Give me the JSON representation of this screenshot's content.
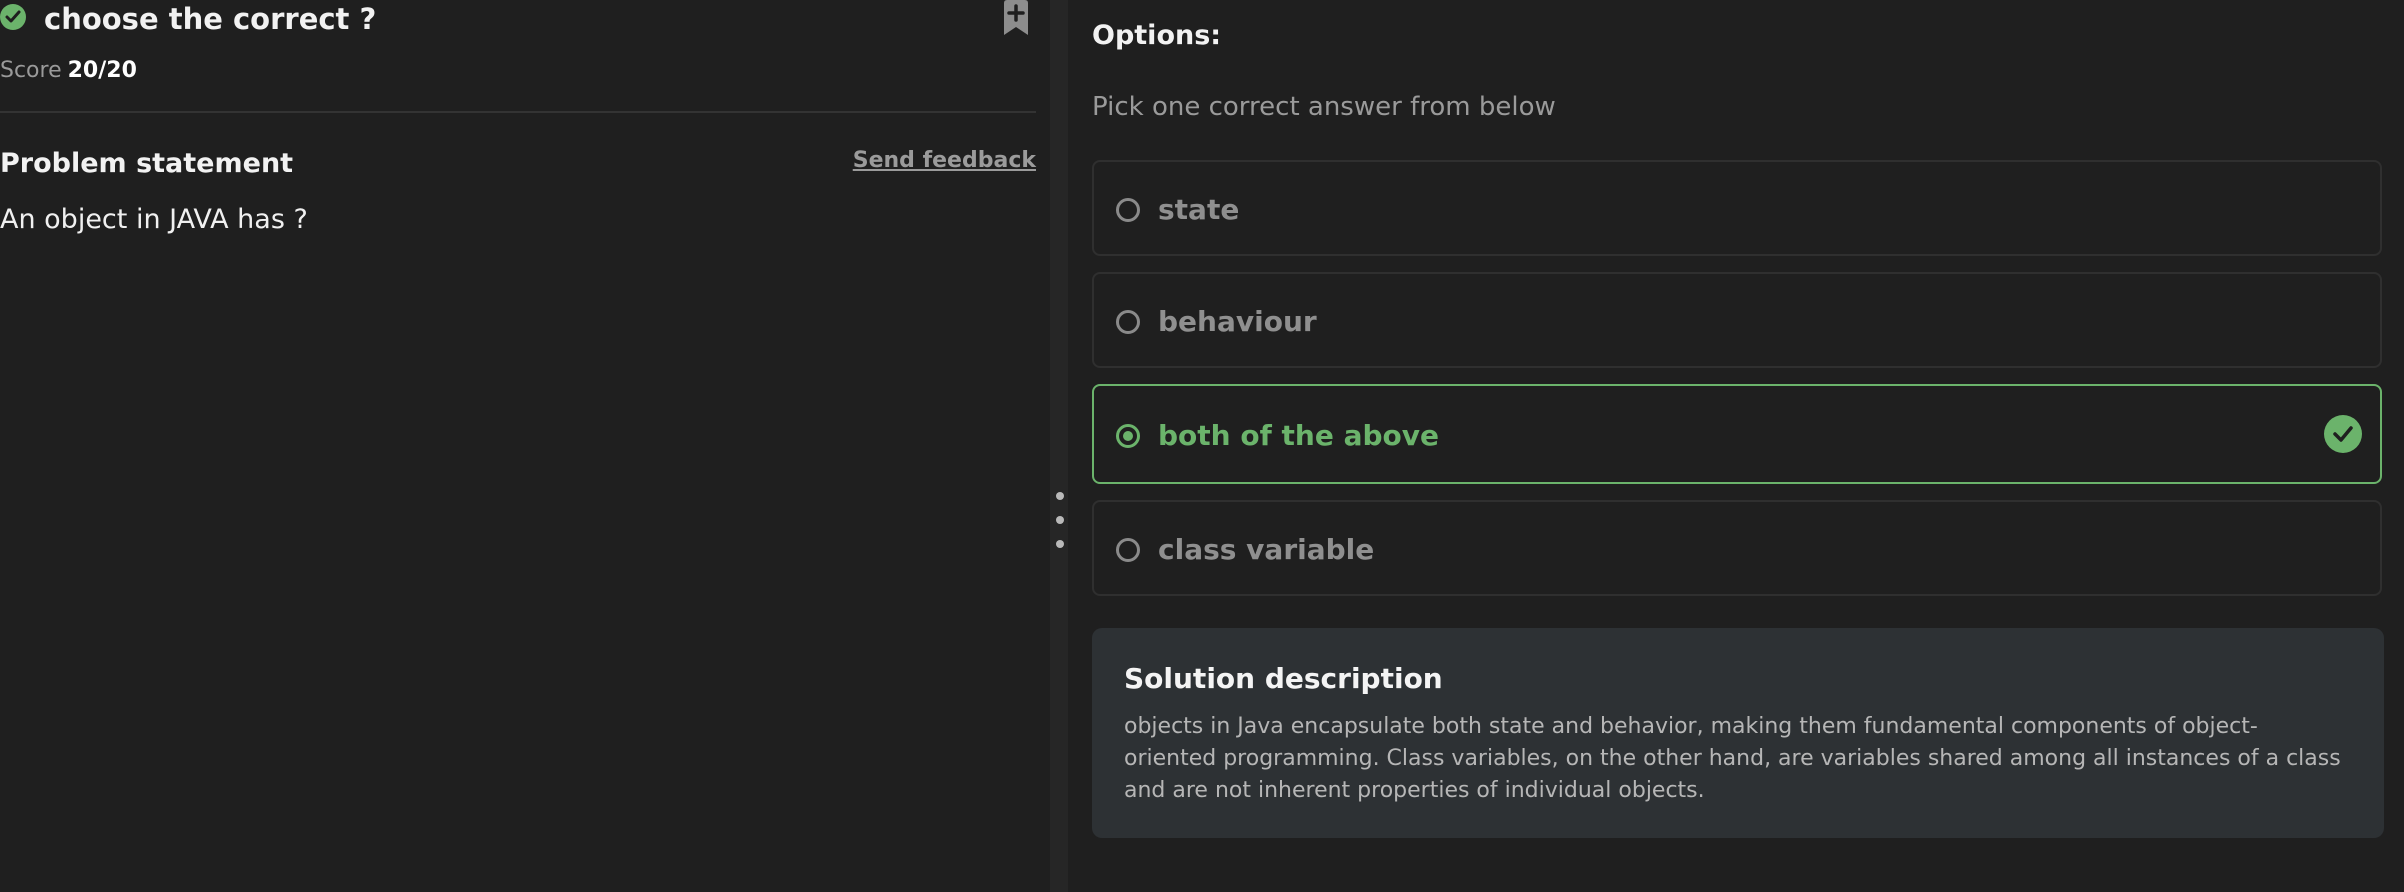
{
  "question": {
    "title": "choose the correct ?",
    "score_label": "Score",
    "score_value": "20/20",
    "status": "correct"
  },
  "problem": {
    "heading": "Problem statement",
    "feedback_label": "Send feedback",
    "statement": "An object in JAVA has ?"
  },
  "options_panel": {
    "heading": "Options:",
    "hint": "Pick one correct answer from below",
    "options": [
      {
        "label": "state",
        "selected": false
      },
      {
        "label": "behaviour",
        "selected": false
      },
      {
        "label": "both of the above",
        "selected": true,
        "correct": true
      },
      {
        "label": "class variable",
        "selected": false
      }
    ]
  },
  "solution": {
    "title": "Solution description",
    "text": "objects in Java encapsulate both state and behavior, making them fundamental components of object-oriented programming. Class variables, on the other hand, are variables shared among all instances of a class and are not inherent properties of individual objects."
  },
  "colors": {
    "background": "#1f1f1f",
    "accent_green": "#6bb36b",
    "solution_bg": "#2d3134",
    "muted_text": "#9a9a9a"
  },
  "icons": [
    "check-circle-icon",
    "bookmark-add-icon",
    "radio-icon",
    "checkmark-icon",
    "drag-handle-icon"
  ]
}
